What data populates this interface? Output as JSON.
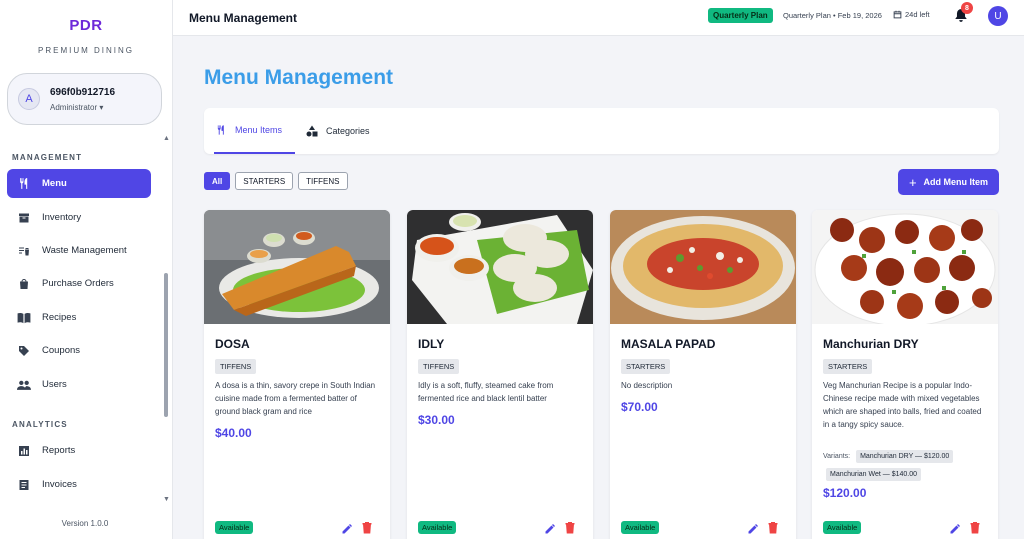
{
  "brand": {
    "name": "PDR",
    "subtitle": "PREMIUM DINING"
  },
  "user": {
    "avatar_letter": "A",
    "id": "696f0b912716",
    "role": "Administrator",
    "role_caret": "▾"
  },
  "sidebar": {
    "management_label": "MANAGEMENT",
    "management_items": [
      {
        "label": "Menu",
        "icon": "utensils-icon",
        "active": true
      },
      {
        "label": "Inventory",
        "icon": "archive-icon"
      },
      {
        "label": "Waste Management",
        "icon": "trash-list-icon"
      },
      {
        "label": "Purchase Orders",
        "icon": "shopping-bag-icon"
      },
      {
        "label": "Recipes",
        "icon": "book-icon"
      },
      {
        "label": "Coupons",
        "icon": "tag-icon"
      },
      {
        "label": "Users",
        "icon": "people-icon"
      }
    ],
    "analytics_label": "ANALYTICS",
    "analytics_items": [
      {
        "label": "Reports",
        "icon": "bar-chart-icon"
      },
      {
        "label": "Invoices",
        "icon": "receipt-icon"
      }
    ],
    "version": "Version 1.0.0"
  },
  "topbar": {
    "title": "Menu Management",
    "plan_badge": "Quarterly Plan",
    "plan_text": "Quarterly Plan • Feb 19, 2026",
    "days_left": "24d left",
    "notification_count": "8",
    "user_initial": "U"
  },
  "main": {
    "page_title": "Menu Management",
    "tabs": [
      {
        "label": "Menu Items",
        "icon": "utensils-icon",
        "active": true
      },
      {
        "label": "Categories",
        "icon": "shapes-icon",
        "active": false
      }
    ],
    "filters": [
      "All",
      "STARTERS",
      "TIFFENS"
    ],
    "active_filter": "All",
    "add_button": "Add Menu Item",
    "add_button_icon": "+"
  },
  "menu_items": [
    {
      "name": "DOSA",
      "category": "TIFFENS",
      "description": "A dosa is a thin, savory crepe in South Indian cuisine made from a fermented batter of ground black gram and rice",
      "price": "$40.00",
      "status": "Available"
    },
    {
      "name": "IDLY",
      "category": "TIFFENS",
      "description": "Idly is a soft, fluffy, steamed cake from fermented rice and black lentil batter",
      "price": "$30.00",
      "status": "Available"
    },
    {
      "name": "MASALA PAPAD",
      "category": "STARTERS",
      "description": "No description",
      "price": "$70.00",
      "status": "Available"
    },
    {
      "name": "Manchurian DRY",
      "category": "STARTERS",
      "description": "Veg Manchurian Recipe is a popular Indo- Chinese recipe made with mixed vegetables which are shaped into balls, fried and coated in a tangy spicy sauce.",
      "variants_label": "Variants:",
      "variants": [
        "Manchurian DRY — $120.00",
        "Manchurian Wet — $140.00"
      ],
      "price": "$120.00",
      "status": "Available"
    }
  ],
  "colors": {
    "accent": "#4f46e5",
    "title": "#3b9de8",
    "available": "#10b981",
    "delete": "#ef4444"
  }
}
